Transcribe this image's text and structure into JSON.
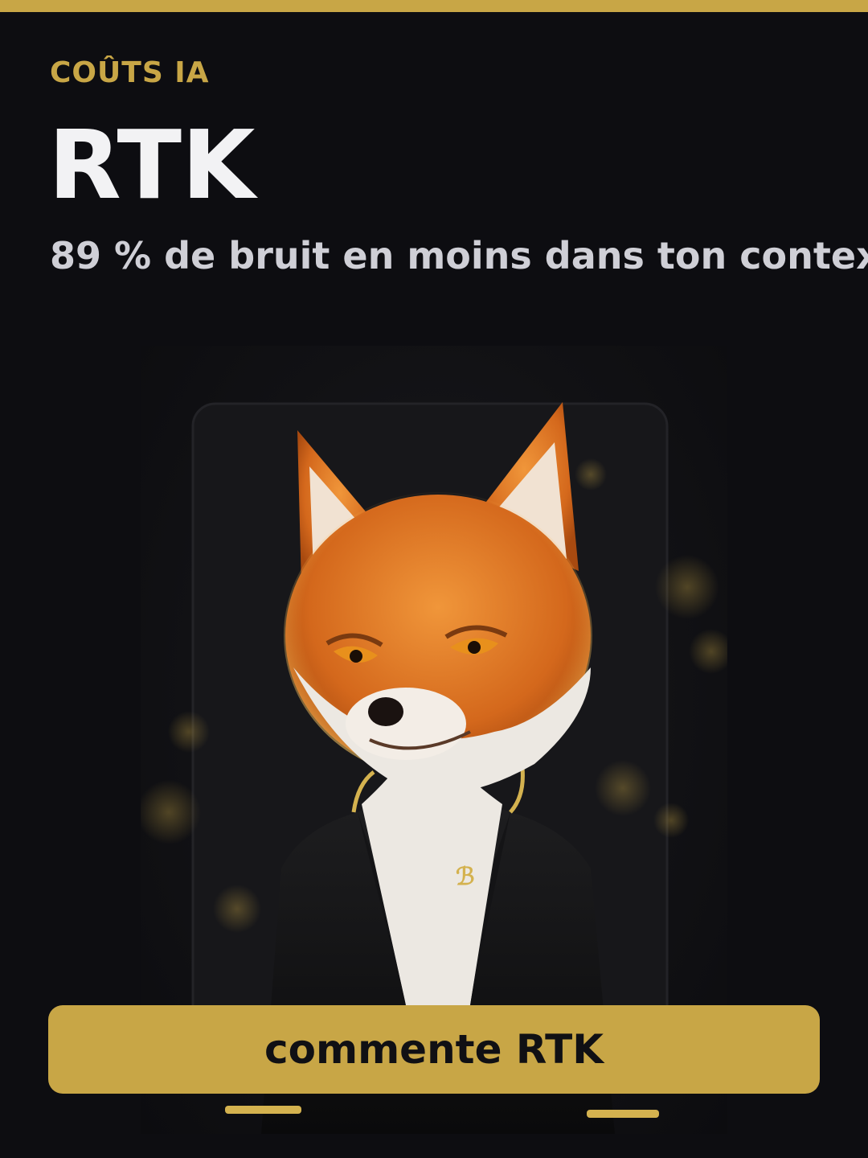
{
  "header": {
    "eyebrow": "COÛTS IA",
    "title": "RTK",
    "subtitle": "89 % de bruit en moins dans ton contex"
  },
  "illustration": {
    "subject": "fox-in-black-suit",
    "pin_letter": "ℬ"
  },
  "cta": {
    "label": "commente RTK"
  },
  "colors": {
    "accent": "#c8a646",
    "background": "#0d0d11",
    "title": "#f2f2f4",
    "subtitle": "#cfcfd6",
    "fox_orange": "#e07a22"
  }
}
